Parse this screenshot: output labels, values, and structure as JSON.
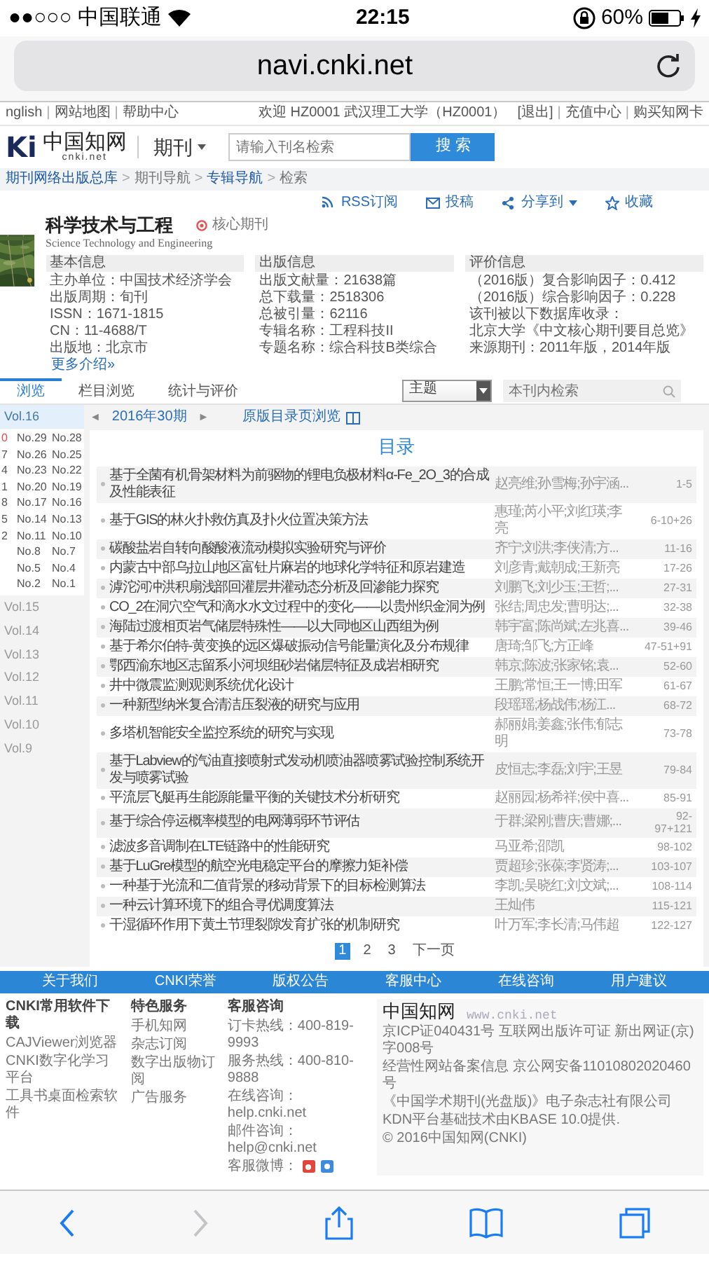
{
  "status_bar": {
    "signal": "●●○○○",
    "carrier": "中国联通",
    "time": "22:15",
    "battery": "60%"
  },
  "address_bar": {
    "url": "navi.cnki.net"
  },
  "top_bar": {
    "separator": "|",
    "links": [
      "nglish",
      "网站地图",
      "帮助中心"
    ],
    "welcome": "欢迎 HZ0001 武汉理工大学（HZ0001）",
    "user_links": [
      "[退出]",
      "充值中心",
      "购买知网卡"
    ]
  },
  "header": {
    "logo": "Ki",
    "logo_cn": "中国知网",
    "logo_sub": "cnki.net",
    "category": "期刊",
    "search": {
      "placeholder": "请输入刊名检索"
    },
    "search_button": "搜 索"
  },
  "breadcrumb": {
    "separator": ">",
    "items": [
      {
        "label": "期刊网络出版总库",
        "link": true
      },
      {
        "label": "期刊导航",
        "link": false
      },
      {
        "label": "专辑导航",
        "link": true
      },
      {
        "label": "检索",
        "link": false
      }
    ]
  },
  "actions": [
    {
      "kind": "rss",
      "label": "RSS订阅"
    },
    {
      "kind": "submit",
      "label": "投稿"
    },
    {
      "kind": "share",
      "label": "分享到"
    },
    {
      "kind": "favorite",
      "label": "收藏"
    }
  ],
  "journal": {
    "title": "科学技术与工程",
    "badge": "核心期刊",
    "english_title": "Science Technology and Engineering",
    "info_sections": [
      {
        "heading": "基本信息",
        "lines": [
          "主办单位：中国技术经济学会",
          "出版周期：旬刊",
          "ISSN：1671-1815",
          "CN：11-4688/T",
          "出版地：北京市"
        ]
      },
      {
        "heading": "出版信息",
        "lines": [
          "出版文献量：21638篇",
          "总下载量：2518306",
          "总被引量：62116",
          "专辑名称：工程科技II",
          "专题名称：综合科技B类综合"
        ]
      },
      {
        "heading": "评价信息",
        "lines": [
          "（2016版）复合影响因子：0.412",
          "（2016版）综合影响因子：0.228",
          "该刊被以下数据库收录：",
          "北京大学《中文核心期刊要目总览》来源期刊：2011年版，2014年版"
        ]
      }
    ],
    "more_link": "更多介绍»"
  },
  "tabs": [
    {
      "label": "浏览",
      "selected": true
    },
    {
      "label": "栏目浏览",
      "selected": false
    },
    {
      "label": "统计与评价",
      "selected": false
    }
  ],
  "filter": {
    "select": "主题",
    "search": {
      "placeholder": "本刊内检索"
    }
  },
  "sidebar": {
    "volumes": [
      {
        "label": "Vol.16",
        "selected": true,
        "issue_rows": [
          [
            {
              "label": "0",
              "selected": true
            },
            {
              "label": "No.29",
              "selected": false
            },
            {
              "label": "No.28",
              "selected": false
            }
          ],
          [
            {
              "label": "7",
              "selected": false
            },
            {
              "label": "No.26",
              "selected": false
            },
            {
              "label": "No.25",
              "selected": false
            }
          ],
          [
            {
              "label": "4",
              "selected": false
            },
            {
              "label": "No.23",
              "selected": false
            },
            {
              "label": "No.22",
              "selected": false
            }
          ],
          [
            {
              "label": "1",
              "selected": false
            },
            {
              "label": "No.20",
              "selected": false
            },
            {
              "label": "No.19",
              "selected": false
            }
          ],
          [
            {
              "label": "8",
              "selected": false
            },
            {
              "label": "No.17",
              "selected": false
            },
            {
              "label": "No.16",
              "selected": false
            }
          ],
          [
            {
              "label": "5",
              "selected": false
            },
            {
              "label": "No.14",
              "selected": false
            },
            {
              "label": "No.13",
              "selected": false
            }
          ],
          [
            {
              "label": "2",
              "selected": false
            },
            {
              "label": "No.11",
              "selected": false
            },
            {
              "label": "No.10",
              "selected": false
            }
          ],
          [
            {
              "label": "No.8",
              "selected": false
            },
            {
              "label": "No.7",
              "selected": false
            }
          ],
          [
            {
              "label": "No.5",
              "selected": false
            },
            {
              "label": "No.4",
              "selected": false
            }
          ],
          [
            {
              "label": "No.2",
              "selected": false
            },
            {
              "label": "No.1",
              "selected": false
            }
          ]
        ]
      },
      {
        "label": "Vol.15",
        "selected": false
      },
      {
        "label": "Vol.14",
        "selected": false
      },
      {
        "label": "Vol.13",
        "selected": false
      },
      {
        "label": "Vol.12",
        "selected": false
      },
      {
        "label": "Vol.11",
        "selected": false
      },
      {
        "label": "Vol.10",
        "selected": false
      },
      {
        "label": "Vol.9",
        "selected": false
      }
    ]
  },
  "issue_nav": {
    "prev": "◄",
    "issue": "2016年30期",
    "next": "►",
    "original_link": "原版目录页浏览"
  },
  "toc": {
    "title": "目录",
    "articles": [
      {
        "title": "基于全菌有机骨架材料为前驱物的锂电负极材料α-Fe_2O_3的合成及性能表征",
        "authors": "赵亮维;孙雪梅;孙宇涵...",
        "pages": "1-5"
      },
      {
        "title": "基于GIS的林火扑救仿真及扑火位置决策方法",
        "authors": "惠瑾;芮小平;刘红瑛;李亮",
        "pages": "6-10+26"
      },
      {
        "title": "碳酸盐岩自转向酸酸液流动模拟实验研究与评价",
        "authors": "齐宁;刘洪;李侠清;方...",
        "pages": "11-16"
      },
      {
        "title": "内蒙古中部乌拉山地区富钍片麻岩的地球化学特征和原岩建造",
        "authors": "刘彦青;戴朝成;王新亮",
        "pages": "17-26"
      },
      {
        "title": "滹沱河冲洪积扇浅部回灌层井灌动态分析及回渗能力探究",
        "authors": "刘鹏飞;刘少玉;王哲;...",
        "pages": "27-31"
      },
      {
        "title": "CO_2在洞穴空气和滴水水文过程中的变化——以贵州织金洞为例",
        "authors": "张结;周忠发;曹明达;...",
        "pages": "32-38"
      },
      {
        "title": "海陆过渡相页岩气储层特殊性——以大同地区山西组为例",
        "authors": "韩宇富;陈尚斌;左兆喜...",
        "pages": "39-46"
      },
      {
        "title": "基于希尔伯特-黄变换的远区爆破振动信号能量演化及分布规律",
        "authors": "唐琦;邹飞;方正峰",
        "pages": "47-51+91"
      },
      {
        "title": "鄂西渝东地区志留系小河坝组砂岩储层特征及成岩相研究",
        "authors": "韩京;陈波;张家铭;袁...",
        "pages": "52-60"
      },
      {
        "title": "井中微震监测观测系统优化设计",
        "authors": "王鹏;常恒;王一博;田军",
        "pages": "61-67"
      },
      {
        "title": "一种新型纳米复合清洁压裂液的研究与应用",
        "authors": "段瑶瑶;杨战伟;杨江...",
        "pages": "68-72"
      },
      {
        "title": "多塔机智能安全监控系统的研究与实现",
        "authors": "郝丽娟;姜鑫;张伟;郁志明",
        "pages": "73-78"
      },
      {
        "title": "基于Labview的汽油直接喷射式发动机喷油器喷雾试验控制系统开发与喷雾试验",
        "authors": "皮恒志;李磊;刘宇;王昱",
        "pages": "79-84"
      },
      {
        "title": "平流层飞艇再生能源能量平衡的关键技术分析研究",
        "authors": "赵丽园;杨希祥;侯中喜...",
        "pages": "85-91"
      },
      {
        "title": "基于综合停运概率模型的电网薄弱环节评估",
        "authors": "于群;梁刚;曹庆;曹娜;...",
        "pages": "92-97+121"
      },
      {
        "title": "滤波多音调制在LTE链路中的性能研究",
        "authors": "马亚希;邵凯",
        "pages": "98-102"
      },
      {
        "title": "基于LuGre模型的航空光电稳定平台的摩擦力矩补偿",
        "authors": "贾超珍;张葆;李贤涛;...",
        "pages": "103-107"
      },
      {
        "title": "一种基于光流和二值背景的移动背景下的目标检测算法",
        "authors": "李凯;吴晓红;刘文斌;...",
        "pages": "108-114"
      },
      {
        "title": "一种云计算环境下的组合寻优调度算法",
        "authors": "王灿伟",
        "pages": "115-121"
      },
      {
        "title": "干湿循环作用下黄土节理裂隙发育扩张的机制研究",
        "authors": "叶万军;李长清;马伟超",
        "pages": "122-127"
      }
    ]
  },
  "pagination": [
    {
      "label": "1",
      "selected": true
    },
    {
      "label": "2",
      "selected": false
    },
    {
      "label": "3",
      "selected": false
    },
    {
      "label": "下一页",
      "selected": false
    }
  ],
  "footer": {
    "nav": [
      "关于我们",
      "CNKI荣誉",
      "版权公告",
      "客服中心",
      "在线咨询",
      "用户建议"
    ],
    "columns": [
      {
        "heading": "CNKI常用软件下载",
        "items": [
          "CAJViewer浏览器",
          "CNKI数字化学习平台",
          "工具书桌面检索软件"
        ]
      },
      {
        "heading": "特色服务",
        "items": [
          "手机知网",
          "杂志订阅",
          "数字出版物订阅",
          "广告服务"
        ]
      }
    ],
    "contact": {
      "heading": "客服咨询",
      "lines": [
        "订卡热线：400-819-9993",
        "服务热线：400-810-9888",
        "在线咨询：help.cnki.net",
        "邮件咨询：help@cnki.net"
      ],
      "weibo_label": "客服微博："
    },
    "about": {
      "logo": "中国知网",
      "url": "www.cnki.net",
      "lines": [
        "京ICP证040431号 互联网出版许可证 新出网证(京)字008号",
        "经营性网站备案信息 京公网安备11010802020460号",
        "《中国学术期刊(光盘版)》电子杂志社有限公司",
        "KDN平台基础技术由KBASE 10.0提供.",
        "© 2016中国知网(CNKI)"
      ]
    }
  },
  "toolbar": [
    {
      "kind": "back",
      "disabled": false
    },
    {
      "kind": "forward",
      "disabled": true
    },
    {
      "kind": "share",
      "disabled": false
    },
    {
      "kind": "bookmarks",
      "disabled": false
    },
    {
      "kind": "tabs",
      "disabled": false
    }
  ]
}
